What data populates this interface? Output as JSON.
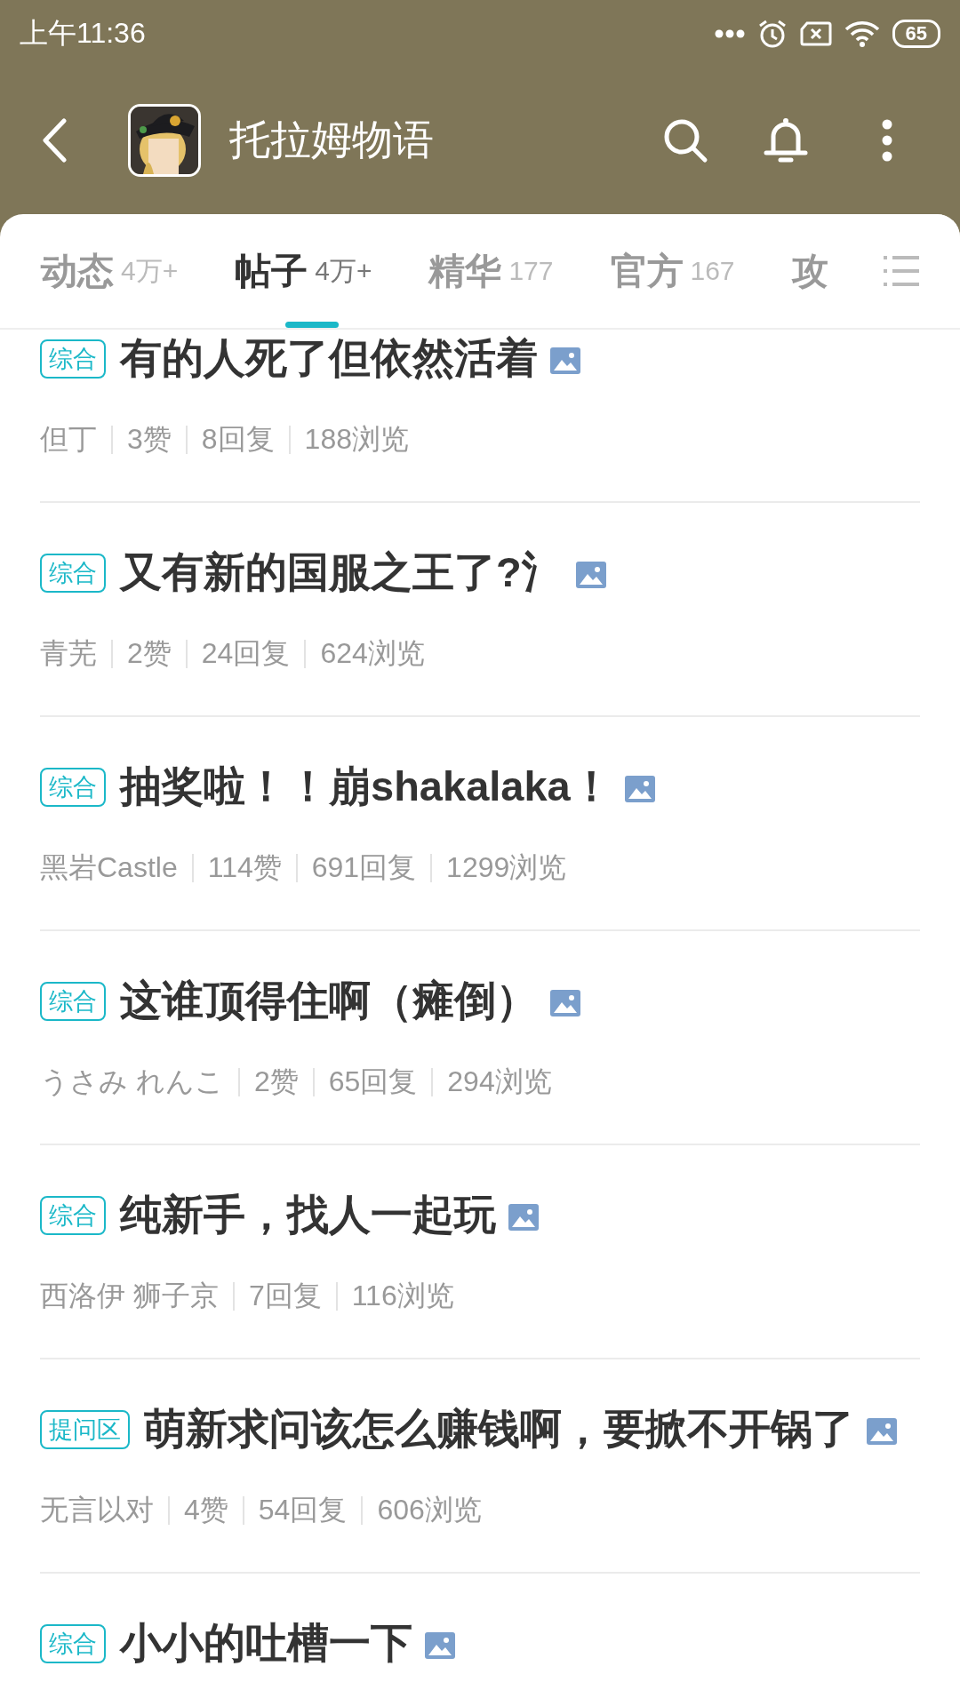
{
  "status_bar": {
    "time": "上午11:36",
    "battery": "65"
  },
  "header": {
    "title": "托拉姆物语"
  },
  "tabs": [
    {
      "label": "动态",
      "count": "4万+",
      "selected": false
    },
    {
      "label": "帖子",
      "count": "4万+",
      "selected": true
    },
    {
      "label": "精华",
      "count": "177",
      "selected": false
    },
    {
      "label": "官方",
      "count": "167",
      "selected": false
    },
    {
      "label": "攻",
      "selected": false
    }
  ],
  "posts": [
    {
      "tag": "综合",
      "title": "有的人死了但依然活着",
      "has_image": true,
      "author": "但丁",
      "stats": [
        "3赞",
        "8回复",
        "188浏览"
      ]
    },
    {
      "tag": "综合",
      "title": "又有新的国服之王了?氵",
      "has_image": true,
      "author": "青芜",
      "stats": [
        "2赞",
        "24回复",
        "624浏览"
      ]
    },
    {
      "tag": "综合",
      "title": "抽奖啦！！崩shakalaka！",
      "has_image": true,
      "author": "黑岩Castle",
      "stats": [
        "114赞",
        "691回复",
        "1299浏览"
      ]
    },
    {
      "tag": "综合",
      "title": "这谁顶得住啊（瘫倒）",
      "has_image": true,
      "author": "うさみ れんこ",
      "stats": [
        "2赞",
        "65回复",
        "294浏览"
      ]
    },
    {
      "tag": "综合",
      "title": "纯新手，找人一起玩",
      "has_image": true,
      "author": "西洛伊 狮子京",
      "stats": [
        "7回复",
        "116浏览"
      ]
    },
    {
      "tag": "提问区",
      "title": "萌新求问该怎么赚钱啊，要掀不开锅了",
      "has_image": true,
      "author": "无言以对",
      "stats": [
        "4赞",
        "54回复",
        "606浏览"
      ]
    },
    {
      "tag": "综合",
      "title": "小小的吐槽一下",
      "has_image": true
    }
  ]
}
